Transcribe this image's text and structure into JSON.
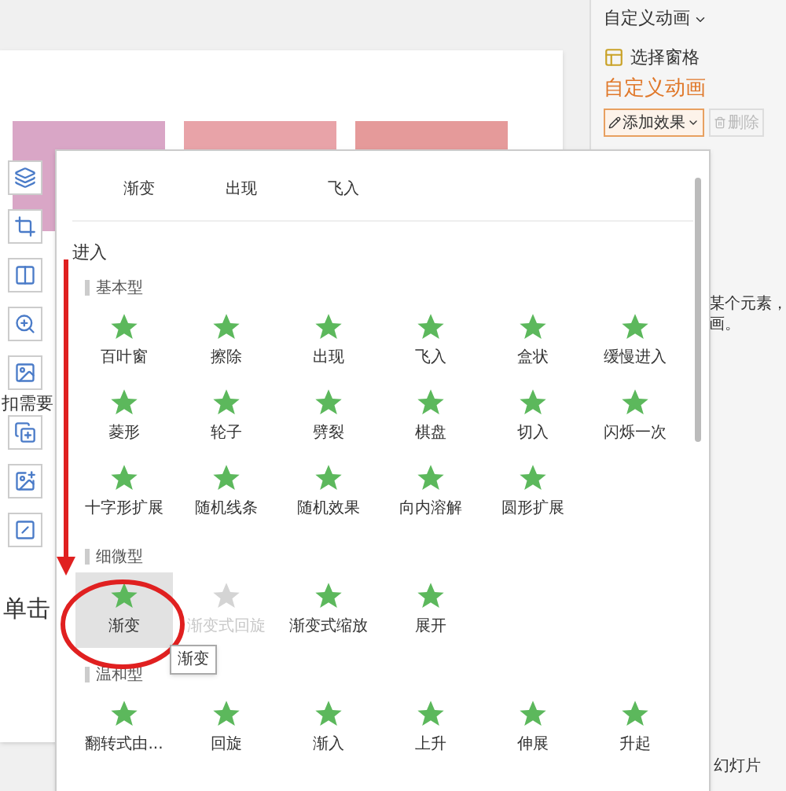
{
  "slide": {
    "text_1": "扣需要",
    "text_2": "单击"
  },
  "right_panel": {
    "title": "自定义动画",
    "select_pane": "选择窗格",
    "section_title": "自定义动画",
    "add_effect": "添加效果",
    "delete": {
      "label": "删除",
      "disabled": true
    },
    "hint_lines": [
      "某个元素，",
      "画。"
    ],
    "slideshow": "幻灯片"
  },
  "effects_menu": {
    "recent": [
      "渐变",
      "出现",
      "飞入"
    ],
    "heading": "进入",
    "tooltip": "渐变",
    "groups": [
      {
        "name": "基本型",
        "items": [
          {
            "label": "百叶窗",
            "selected": false,
            "disabled": false
          },
          {
            "label": "擦除",
            "selected": false,
            "disabled": false
          },
          {
            "label": "出现",
            "selected": false,
            "disabled": false
          },
          {
            "label": "飞入",
            "selected": false,
            "disabled": false
          },
          {
            "label": "盒状",
            "selected": false,
            "disabled": false
          },
          {
            "label": "缓慢进入",
            "selected": false,
            "disabled": false
          },
          {
            "label": "菱形",
            "selected": false,
            "disabled": false
          },
          {
            "label": "轮子",
            "selected": false,
            "disabled": false
          },
          {
            "label": "劈裂",
            "selected": false,
            "disabled": false
          },
          {
            "label": "棋盘",
            "selected": false,
            "disabled": false
          },
          {
            "label": "切入",
            "selected": false,
            "disabled": false
          },
          {
            "label": "闪烁一次",
            "selected": false,
            "disabled": false
          },
          {
            "label": "十字形扩展",
            "selected": false,
            "disabled": false
          },
          {
            "label": "随机线条",
            "selected": false,
            "disabled": false
          },
          {
            "label": "随机效果",
            "selected": false,
            "disabled": false
          },
          {
            "label": "向内溶解",
            "selected": false,
            "disabled": false
          },
          {
            "label": "圆形扩展",
            "selected": false,
            "disabled": false
          }
        ]
      },
      {
        "name": "细微型",
        "items": [
          {
            "label": "渐变",
            "selected": true,
            "disabled": false
          },
          {
            "label": "渐变式回旋",
            "selected": false,
            "disabled": true
          },
          {
            "label": "渐变式缩放",
            "selected": false,
            "disabled": false
          },
          {
            "label": "展开",
            "selected": false,
            "disabled": false
          }
        ]
      },
      {
        "name": "温和型",
        "items": [
          {
            "label": "翻转式由...",
            "selected": false,
            "disabled": false
          },
          {
            "label": "回旋",
            "selected": false,
            "disabled": false
          },
          {
            "label": "渐入",
            "selected": false,
            "disabled": false
          },
          {
            "label": "上升",
            "selected": false,
            "disabled": false
          },
          {
            "label": "伸展",
            "selected": false,
            "disabled": false
          },
          {
            "label": "升起",
            "selected": false,
            "disabled": false
          }
        ]
      }
    ]
  }
}
